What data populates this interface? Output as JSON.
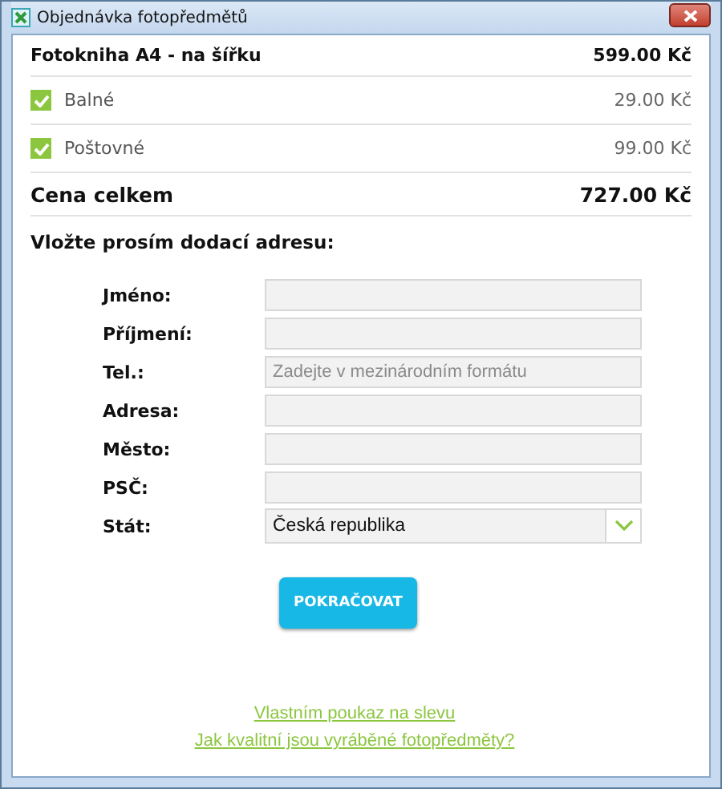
{
  "window": {
    "title": "Objednávka fotopředmětů"
  },
  "product": {
    "name": "Fotokniha A4 - na šířku",
    "price": "599.00 Kč"
  },
  "extras": [
    {
      "label": "Balné",
      "price": "29.00 Kč",
      "checked": true
    },
    {
      "label": "Poštovné",
      "price": "99.00 Kč",
      "checked": true
    }
  ],
  "total": {
    "label": "Cena celkem",
    "price": "727.00 Kč"
  },
  "address_heading": "Vložte prosím dodací adresu:",
  "fields": [
    {
      "label": "Jméno:",
      "kind": "text"
    },
    {
      "label": "Příjmení:",
      "kind": "text"
    },
    {
      "label": "Tel.:",
      "kind": "text",
      "placeholder": "Zadejte v mezinárodním formátu"
    },
    {
      "label": "Adresa:",
      "kind": "text"
    },
    {
      "label": "Město:",
      "kind": "text"
    },
    {
      "label": "PSČ:",
      "kind": "text"
    },
    {
      "label": "Stát:",
      "kind": "select",
      "value": "Česká republika"
    }
  ],
  "continue_button": "POKRAČOVAT",
  "links": [
    "Vlastním poukaz na slevu",
    "Jak kvalitní jsou vyráběné fotopředměty?"
  ]
}
